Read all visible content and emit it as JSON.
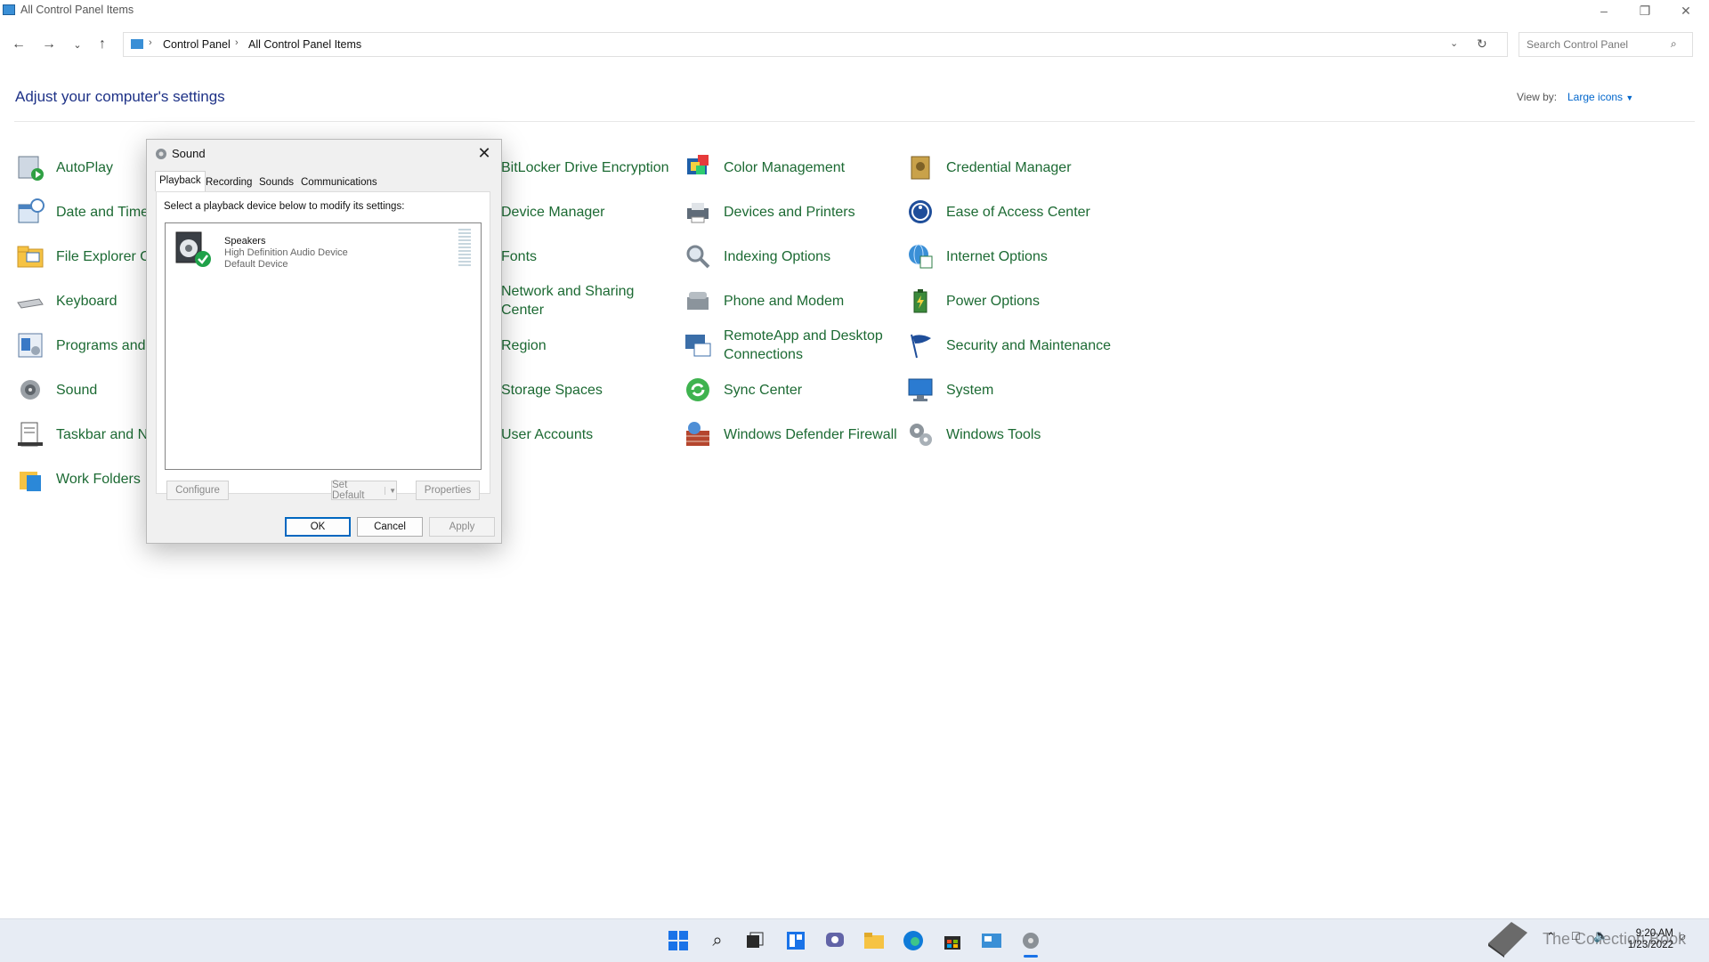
{
  "window": {
    "title": "All Control Panel Items"
  },
  "nav": {
    "breadcrumb": [
      "Control Panel",
      "All Control Panel Items"
    ],
    "search_placeholder": "Search Control Panel"
  },
  "content": {
    "heading": "Adjust your computer's settings",
    "view_by_label": "View by:",
    "view_by_value": "Large icons"
  },
  "items": [
    [
      "AutoPlay",
      "Date and Time",
      "File Explorer O",
      "Keyboard",
      "Programs and",
      "Sound",
      "Taskbar and Na",
      "Work Folders"
    ],
    [
      "BitLocker Drive Encryption",
      "Device Manager",
      "Fonts",
      "Network and Sharing Center",
      "Region",
      "Storage Spaces",
      "User Accounts"
    ],
    [
      "Color Management",
      "Devices and Printers",
      "Indexing Options",
      "Phone and Modem",
      "RemoteApp and Desktop Connections",
      "Sync Center",
      "Windows Defender Firewall"
    ],
    [
      "Credential Manager",
      "Ease of Access Center",
      "Internet Options",
      "Power Options",
      "Security and Maintenance",
      "System",
      "Windows Tools"
    ]
  ],
  "dialog": {
    "title": "Sound",
    "tabs": [
      "Playback",
      "Recording",
      "Sounds",
      "Communications"
    ],
    "active_tab": "Playback",
    "instruction": "Select a playback device below to modify its settings:",
    "device": {
      "name": "Speakers",
      "desc": "High Definition Audio Device",
      "status": "Default Device"
    },
    "buttons": {
      "configure": "Configure",
      "set_default": "Set Default",
      "properties": "Properties",
      "ok": "OK",
      "cancel": "Cancel",
      "apply": "Apply"
    }
  },
  "taskbar": {
    "time": "9:20 AM",
    "date": "1/23/2022",
    "watermark": "The Collection Book"
  },
  "colors": {
    "link_green": "#1c6a33",
    "heading_blue": "#1e3287",
    "accent": "#0067c0"
  }
}
